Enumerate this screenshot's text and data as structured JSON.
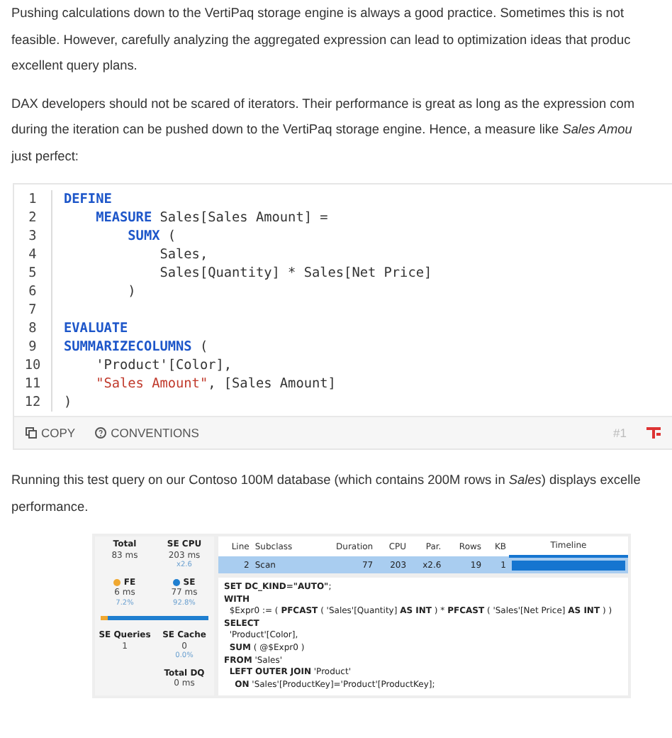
{
  "paragraphs": [
    {
      "lines": [
        "Pushing calculations down to the VertiPaq storage engine is always a good practice. Sometimes this is not",
        "feasible. However, carefully analyzing the aggregated expression can lead to optimization ideas that produc",
        "excellent query plans."
      ]
    },
    {
      "lines": [
        "DAX developers should not be scared of iterators. Their performance is great as long as the expression com",
        "during the iteration can be pushed down to the VertiPaq storage engine. Hence, a measure like *Sales Amou*",
        "just perfect:"
      ]
    }
  ],
  "code_block": {
    "lines": [
      {
        "number": "1",
        "tokens": [
          {
            "text": "DEFINE",
            "kind": "keyword"
          }
        ]
      },
      {
        "number": "2",
        "tokens": [
          {
            "text": "    MEASURE",
            "kind": "keyword"
          },
          {
            "text": " Sales[Sales Amount] =",
            "kind": "plain"
          }
        ]
      },
      {
        "number": "3",
        "tokens": [
          {
            "text": "        SUMX",
            "kind": "keyword"
          },
          {
            "text": " (",
            "kind": "plain"
          }
        ]
      },
      {
        "number": "4",
        "tokens": [
          {
            "text": "            Sales,",
            "kind": "plain"
          }
        ]
      },
      {
        "number": "5",
        "tokens": [
          {
            "text": "            Sales[Quantity] * Sales[Net Price]",
            "kind": "plain"
          }
        ]
      },
      {
        "number": "6",
        "tokens": [
          {
            "text": "        )",
            "kind": "plain"
          }
        ]
      },
      {
        "number": "7"
      },
      {
        "number": "8",
        "tokens": [
          {
            "text": "EVALUATE",
            "kind": "keyword"
          }
        ]
      },
      {
        "number": "9",
        "tokens": [
          {
            "text": "SUMMARIZECOLUMNS",
            "kind": "keyword"
          },
          {
            "text": " (",
            "kind": "plain"
          }
        ]
      },
      {
        "number": "10",
        "tokens": [
          {
            "text": "    'Product'[Color],",
            "kind": "plain"
          }
        ]
      },
      {
        "number": "11",
        "tokens": [
          {
            "text": "    \"Sales Amount\"",
            "kind": "string"
          },
          {
            "text": ", [Sales Amount]",
            "kind": "plain"
          }
        ]
      },
      {
        "number": "12",
        "tokens": [
          {
            "text": ")",
            "kind": "plain"
          }
        ]
      }
    ],
    "footer": {
      "copy": "COPY",
      "conventions": "CONVENTIONS",
      "index": "#1"
    }
  },
  "paragraph_after": {
    "lines": [
      "Running this test query on our Contoso 100M database (which contains 200M rows in *Sales*) displays excelle",
      "performance."
    ]
  },
  "server_timings": {
    "stats": [
      {
        "label": "Total",
        "value": "83 ms"
      },
      {
        "label": "SE CPU",
        "value": "203 ms",
        "note": "x2.6"
      },
      {
        "label": "FE",
        "value": "6 ms",
        "note": "7.2%",
        "color": "#f0a830"
      },
      {
        "label": "SE",
        "value": "77 ms",
        "note": "92.8%",
        "color": "#1f7fd0"
      }
    ],
    "fe_bar": {
      "level": 0.072
    },
    "stats_lower": [
      {
        "label": "SE Queries",
        "value": "1"
      },
      {
        "label": "SE Cache",
        "value": "0",
        "note": "0.0%"
      },
      {
        "label": "Total DQ",
        "value": "0 ms"
      }
    ],
    "table": {
      "columns": [
        "Line",
        "Subclass",
        "Duration",
        "CPU",
        "Par.",
        "Rows",
        "KB",
        "Timeline"
      ],
      "rows": [
        {
          "selected": true,
          "cells": [
            "2",
            "Scan",
            "77",
            "203",
            "x2.6",
            "19",
            "1"
          ],
          "level": 1
        }
      ]
    },
    "query_lines": [
      "**SET DC_KIND=\"AUTO\"**;",
      "**WITH**",
      "  $Expr0 := ( **PFCAST** ( 'Sales'[Quantity] **AS INT** ) * **PFCAST** ( 'Sales'[Net Price] **AS INT** ) )",
      "**SELECT**",
      "  'Product'[Color],",
      "  **SUM** ( @$Expr0 )",
      "**FROM** 'Sales'",
      "  **LEFT OUTER JOIN** 'Product'",
      "    **ON** 'Sales'[ProductKey]='Product'[ProductKey];"
    ]
  }
}
